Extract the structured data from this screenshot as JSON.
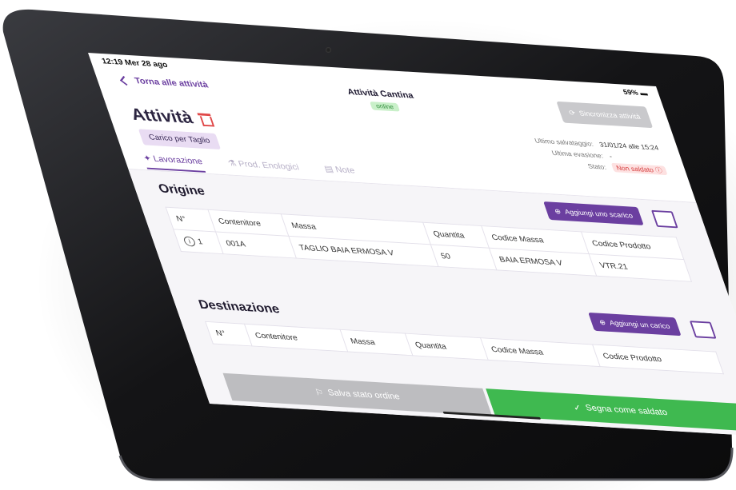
{
  "status_bar": {
    "time": "12:19  Mer 28 ago",
    "battery": "59% ▬"
  },
  "header": {
    "back_label": "Torna alle attività",
    "title": "Attività Cantina",
    "online_badge": "online",
    "sync_button": "Sincronizza attività"
  },
  "page": {
    "title": "Attività",
    "subtitle_tag": "Carico per Taglio"
  },
  "meta": {
    "last_saved_label": "Ultimo salvataggio:",
    "last_saved_value": "31/01/24 alle 15:24",
    "last_evasion_label": "Ultima evasione:",
    "last_evasion_value": "-",
    "status_label": "Stato:",
    "status_value": "Non saldato ⓘ"
  },
  "tabs": [
    {
      "label": "Lavorazione",
      "active": true
    },
    {
      "label": "Prod. Enologici",
      "active": false
    },
    {
      "label": "Note",
      "active": false
    }
  ],
  "origin": {
    "title": "Origine",
    "add_button": "Aggiungi uno scarico",
    "columns": [
      "N°",
      "Contenitore",
      "Massa",
      "Quantita",
      "Codice Massa",
      "Codice Prodotto"
    ],
    "rows": [
      {
        "n": "1",
        "contenitore": "001A",
        "massa": "TAGLIO BAIA ERMOSA V",
        "quantita": "50",
        "codice_massa": "BAIA ERMOSA V",
        "codice_prodotto": "VTR.21"
      }
    ]
  },
  "destination": {
    "title": "Destinazione",
    "add_button": "Aggiungi un carico",
    "columns": [
      "N°",
      "Contenitore",
      "Massa",
      "Quantita",
      "Codice Massa",
      "Codice Prodotto"
    ]
  },
  "footer": {
    "save_button": "Salva stato ordine",
    "paid_button": "Segna come saldato"
  },
  "colors": {
    "accent": "#6b3fa0",
    "success": "#3fb950",
    "danger": "#e04848",
    "bezel": "#141416"
  }
}
